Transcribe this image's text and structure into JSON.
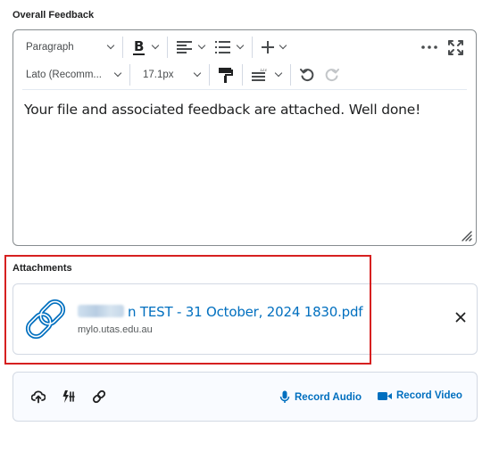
{
  "overall_feedback": {
    "label": "Overall Feedback",
    "toolbar": {
      "block_format": "Paragraph",
      "font_family": "Lato (Recomm...",
      "font_size": "17.1px"
    },
    "content": "Your file and associated feedback are attached. Well done!"
  },
  "attachments": {
    "label": "Attachments",
    "file": {
      "name": "TEST - 31 October, 2024 1830.pdf",
      "name_prefix_redacted": "n",
      "domain": "mylo.utas.edu.au",
      "icon": "link-icon"
    }
  },
  "tools": {
    "record_audio": "Record Audio",
    "record_video": "Record Video",
    "icons": [
      "upload-cloud-icon",
      "quicklink-icon",
      "link-icon"
    ]
  },
  "colors": {
    "link": "#006fbf",
    "highlight": "#d62020",
    "border": "#868c8f"
  }
}
